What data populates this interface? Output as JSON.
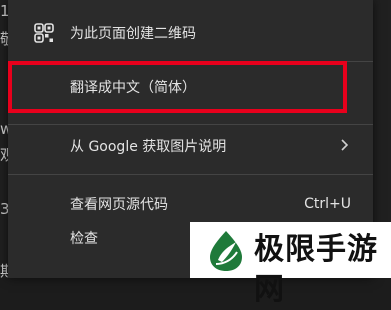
{
  "backdrop": {
    "glyphs": [
      "1",
      "敬",
      "w",
      "观",
      "3",
      "期测"
    ]
  },
  "menu": {
    "items": [
      {
        "label": "为此页面创建二维码",
        "icon": "qr-code-icon"
      },
      {
        "label": "翻译成中文（简体）"
      },
      {
        "label": "从 Google 获取图片说明",
        "icon": "chevron-right-icon"
      },
      {
        "label": "查看网页源代码",
        "shortcut": "Ctrl+U"
      },
      {
        "label": "检查"
      }
    ]
  },
  "highlight_color": "#e8001c",
  "watermark": {
    "text": "极限手游网",
    "logo": "leaf-drop-logo"
  }
}
